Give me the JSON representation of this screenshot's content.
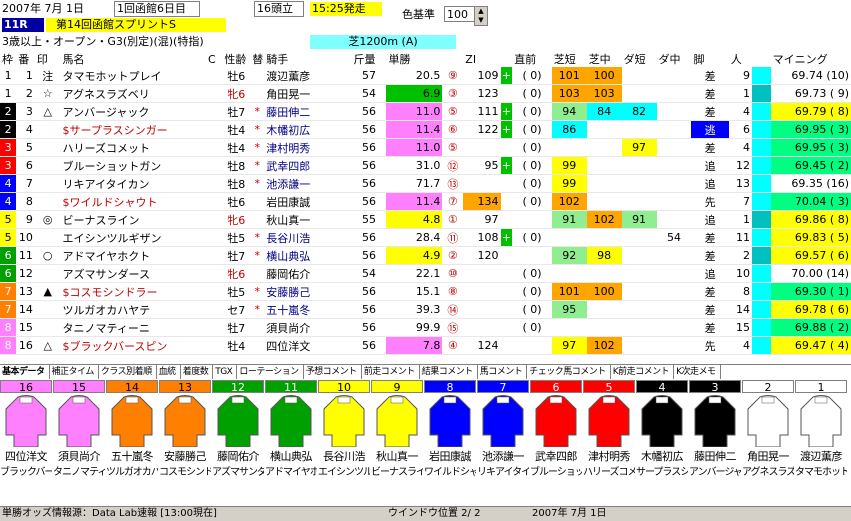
{
  "header": {
    "date": "2007年 7月 1日",
    "meeting": "1回函館6日目",
    "race_no": "11R",
    "race_name": "第14回函館スプリントS",
    "runners": "16頭立",
    "post_time": "15:25発走",
    "color_label": "色基準",
    "color_value": "100",
    "conditions": "3歳以上・オープン・G3(別定)(混)(特指)",
    "course": "芝1200m (A)"
  },
  "columns": [
    "枠",
    "番",
    "印",
    "馬名",
    "C",
    "性齢",
    "替",
    "騎手",
    "斤量",
    "単勝",
    "",
    "ZI",
    "",
    "直前",
    "芝短",
    "芝中",
    "ダ短",
    "ダ中",
    "脚",
    "人",
    "",
    "マイニング"
  ],
  "colors": {
    "waku1": "#ffffff",
    "waku2": "#000000",
    "waku3": "#ff0000",
    "waku4": "#0000ff",
    "waku5": "#ffff00",
    "waku6": "#00a000",
    "waku7": "#ff8000",
    "waku8": "#ff80ff",
    "cyan": "#00ffff",
    "yellow": "#ffff00",
    "orange": "#ffa500",
    "lightgreen": "#90ee90",
    "green": "#00c000",
    "magenta": "#ff00ff",
    "olive": "#00ff80"
  },
  "horses": [
    {
      "waku": "1",
      "num": "1",
      "mark": "注",
      "name": "タマモホットプレイ",
      "c": "",
      "sex": "牡6",
      "change": "",
      "jockey": "渡辺薫彦",
      "wt": "57",
      "odds": "20.5",
      "pop": "⑨",
      "zi": "109",
      "plus": "+",
      "chokuzen": "(  0)",
      "shibatan": "101",
      "shibanaka": "100",
      "datan": "",
      "danaka": "",
      "kyaku": "差",
      "nin": "9",
      "mining": "69.74 (10)"
    },
    {
      "waku": "1",
      "num": "2",
      "mark": "☆",
      "name": "アグネスラズベリ",
      "c": "",
      "sex": "牝6",
      "change": "",
      "jockey": "角田晃一",
      "wt": "54",
      "odds": "6.9",
      "pop": "③",
      "zi": "123",
      "plus": "",
      "chokuzen": "(  0)",
      "shibatan": "103",
      "shibanaka": "103",
      "datan": "",
      "danaka": "",
      "kyaku": "差",
      "nin": "1",
      "mining": "69.73 ( 9)"
    },
    {
      "waku": "2",
      "num": "3",
      "mark": "△",
      "name": "アンバージャック",
      "c": "",
      "sex": "牡7",
      "change": "*",
      "jockey": "藤田伸二",
      "wt": "56",
      "odds": "11.0",
      "pop": "⑤",
      "zi": "111",
      "plus": "+",
      "chokuzen": "(  0)",
      "shibatan": "94",
      "shibanaka": "84",
      "datan": "82",
      "danaka": "",
      "kyaku": "差",
      "nin": "4",
      "mining": "69.79 ( 8)"
    },
    {
      "waku": "2",
      "num": "4",
      "mark": "",
      "name": "$サープラスシンガー",
      "c": "",
      "sex": "牡4",
      "change": "*",
      "jockey": "木幡初広",
      "wt": "56",
      "odds": "11.4",
      "pop": "⑥",
      "zi": "122",
      "plus": "+",
      "chokuzen": "(  0)",
      "shibatan": "86",
      "shibanaka": "",
      "datan": "",
      "danaka": "",
      "kyaku": "逃",
      "nin": "6",
      "mining": "69.95 ( 3)"
    },
    {
      "waku": "3",
      "num": "5",
      "mark": "",
      "name": "ハリーズコメット",
      "c": "",
      "sex": "牡4",
      "change": "*",
      "jockey": "津村明秀",
      "wt": "56",
      "odds": "11.0",
      "pop": "⑤",
      "zi": "",
      "plus": "",
      "chokuzen": "(  0)",
      "shibatan": "",
      "shibanaka": "",
      "datan": "97",
      "danaka": "",
      "kyaku": "差",
      "nin": "4",
      "mining": "69.95 ( 3)"
    },
    {
      "waku": "3",
      "num": "6",
      "mark": "",
      "name": "ブルーショットガン",
      "c": "",
      "sex": "牡8",
      "change": "*",
      "jockey": "武幸四郎",
      "wt": "56",
      "odds": "31.0",
      "pop": "⑫",
      "zi": "95",
      "plus": "+",
      "chokuzen": "(  0)",
      "shibatan": "99",
      "shibanaka": "",
      "datan": "",
      "danaka": "",
      "kyaku": "追",
      "nin": "12",
      "mining": "69.45 ( 2)"
    },
    {
      "waku": "4",
      "num": "7",
      "mark": "",
      "name": "リキアイタイカン",
      "c": "",
      "sex": "牡8",
      "change": "*",
      "jockey": "池添謙一",
      "wt": "56",
      "odds": "71.7",
      "pop": "⑬",
      "zi": "",
      "plus": "",
      "chokuzen": "(  0)",
      "shibatan": "99",
      "shibanaka": "",
      "datan": "",
      "danaka": "",
      "kyaku": "追",
      "nin": "13",
      "mining": "69.35 (16)"
    },
    {
      "waku": "4",
      "num": "8",
      "mark": "",
      "name": "$ワイルドシャウト",
      "c": "",
      "sex": "牡6",
      "change": "",
      "jockey": "岩田康誠",
      "wt": "56",
      "odds": "11.4",
      "pop": "⑦",
      "zi": "134",
      "plus": "",
      "chokuzen": "(  0)",
      "shibatan": "102",
      "shibanaka": "",
      "datan": "",
      "danaka": "",
      "kyaku": "先",
      "nin": "7",
      "mining": "70.04 ( 3)"
    },
    {
      "waku": "5",
      "num": "9",
      "mark": "◎",
      "name": "ビーナスライン",
      "c": "",
      "sex": "牝6",
      "change": "",
      "jockey": "秋山真一",
      "wt": "55",
      "odds": "4.8",
      "pop": "①",
      "zi": "97",
      "plus": "",
      "chokuzen": "",
      ",shibatan": "91",
      "shibatan": "91",
      "shibanaka": "102",
      "datan": "91",
      "danaka": "",
      "kyaku": "追",
      "nin": "1",
      "mining": "69.86 ( 8)"
    },
    {
      "waku": "5",
      "num": "10",
      "mark": "",
      "name": "エイシンツルギザン",
      "c": "",
      "sex": "牡5",
      "change": "*",
      "jockey": "長谷川浩",
      "wt": "56",
      "odds": "28.4",
      "pop": "⑪",
      "zi": "108",
      "plus": "+",
      "chokuzen": "(  0)",
      "shibatan": "",
      "shibanaka": "",
      "datan": "",
      "danaka": "54",
      "kyaku": "差",
      "nin": "11",
      "mining": "69.83 ( 5)"
    },
    {
      "waku": "6",
      "num": "11",
      "mark": "○",
      "name": "アドマイヤホクト",
      "c": "",
      "sex": "牡7",
      "change": "*",
      "jockey": "横山典弘",
      "wt": "56",
      "odds": "4.9",
      "pop": "②",
      "zi": "120",
      "plus": "",
      "chokuzen": "",
      "shibatan": "92",
      "shibanaka": "98",
      "datan": "",
      "danaka": "",
      "kyaku": "差",
      "nin": "2",
      "mining": "69.57 ( 6)"
    },
    {
      "waku": "6",
      "num": "12",
      "mark": "",
      "name": "アズマサンダース",
      "c": "",
      "sex": "牝6",
      "change": "",
      "jockey": "藤岡佑介",
      "wt": "54",
      "odds": "22.1",
      "pop": "⑩",
      "zi": "",
      "plus": "",
      "chokuzen": "(  0)",
      "shibatan": "",
      "shibanaka": "",
      "datan": "",
      "danaka": "",
      "kyaku": "追",
      "nin": "10",
      "mining": "70.00 (14)"
    },
    {
      "waku": "7",
      "num": "13",
      "mark": "▲",
      "name": "$コスモシンドラー",
      "c": "",
      "sex": "牡5",
      "change": "*",
      "jockey": "安藤勝己",
      "wt": "56",
      "odds": "15.1",
      "pop": "⑧",
      "zi": "",
      "plus": "",
      "chokuzen": "(  0)",
      "shibatan": "101",
      "shibanaka": "100",
      "datan": "",
      "danaka": "",
      "kyaku": "差",
      "nin": "8",
      "mining": "69.30 ( 1)"
    },
    {
      "waku": "7",
      "num": "14",
      "mark": "",
      "name": "ツルガオカハヤテ",
      "c": "",
      "sex": "セ7",
      "change": "*",
      "jockey": "五十嵐冬",
      "wt": "56",
      "odds": "39.3",
      "pop": "⑭",
      "zi": "",
      "plus": "",
      "chokuzen": "(  0)",
      "shibatan": "95",
      "shibanaka": "",
      "datan": "",
      "danaka": "",
      "kyaku": "差",
      "nin": "14",
      "mining": "69.78 ( 6)"
    },
    {
      "waku": "8",
      "num": "15",
      "mark": "",
      "name": "タニノマティーニ",
      "c": "",
      "sex": "牡7",
      "change": "",
      "jockey": "須貝尚介",
      "wt": "56",
      "odds": "99.9",
      "pop": "⑮",
      "zi": "",
      "plus": "",
      "chokuzen": "(  0)",
      "shibatan": "",
      "shibanaka": "",
      "datan": "",
      "danaka": "",
      "kyaku": "差",
      "nin": "15",
      "mining": "69.88 ( 2)"
    },
    {
      "waku": "8",
      "num": "16",
      "mark": "△",
      "name": "$ブラックバースピン",
      "c": "",
      "sex": "牡4",
      "change": "",
      "jockey": "四位洋文",
      "wt": "56",
      "odds": "7.8",
      "pop": "④",
      "zi": "124",
      "plus": "",
      "chokuzen": "",
      "shibatan": "97",
      "shibanaka": "102",
      "datan": "",
      "danaka": "",
      "kyaku": "先",
      "nin": "4",
      "mining": "69.47 ( 4)"
    }
  ],
  "tabs": [
    "基本データ",
    "補正タイム",
    "クラス別着順",
    "血統",
    "着度数",
    "TGX",
    "ローテーション",
    "予想コメント",
    "前走コメント",
    "結果コメント",
    "馬コメント",
    "チェック馬コメント",
    "K前走コメント",
    "K次走メモ"
  ],
  "silks": [
    {
      "num": "16",
      "jockey": "四位洋文",
      "horse": "ブラックバースピン",
      "bg": "#ff80ff",
      "fg": "#000"
    },
    {
      "num": "15",
      "jockey": "須貝尚介",
      "horse": "タニノマティーニ",
      "bg": "#ff80ff",
      "fg": "#000"
    },
    {
      "num": "14",
      "jockey": "五十嵐冬",
      "horse": "ツルガオカハヤテ",
      "bg": "#ff8000",
      "fg": "#000"
    },
    {
      "num": "13",
      "jockey": "安藤勝己",
      "horse": "コスモシンドラー",
      "bg": "#ff8000",
      "fg": "#000"
    },
    {
      "num": "12",
      "jockey": "藤岡佑介",
      "horse": "アズマサンダース",
      "bg": "#00a000",
      "fg": "#fff"
    },
    {
      "num": "11",
      "jockey": "横山典弘",
      "horse": "アドマイヤホクト",
      "bg": "#00a000",
      "fg": "#fff"
    },
    {
      "num": "10",
      "jockey": "長谷川浩",
      "horse": "エイシンツルギザン",
      "bg": "#ffff00",
      "fg": "#000"
    },
    {
      "num": "9",
      "jockey": "秋山真一",
      "horse": "ビーナスライン",
      "bg": "#ffff00",
      "fg": "#000"
    },
    {
      "num": "8",
      "jockey": "岩田康誠",
      "horse": "ワイルドシャウト",
      "bg": "#0000ff",
      "fg": "#fff"
    },
    {
      "num": "7",
      "jockey": "池添謙一",
      "horse": "リキアイタイカン",
      "bg": "#0000ff",
      "fg": "#fff"
    },
    {
      "num": "6",
      "jockey": "武幸四郎",
      "horse": "ブルーショットガン",
      "bg": "#ff0000",
      "fg": "#fff"
    },
    {
      "num": "5",
      "jockey": "津村明秀",
      "horse": "ハリーズコメット",
      "bg": "#ff0000",
      "fg": "#fff"
    },
    {
      "num": "4",
      "jockey": "木幡初広",
      "horse": "サープラスシンガー",
      "bg": "#000000",
      "fg": "#fff"
    },
    {
      "num": "3",
      "jockey": "藤田伸二",
      "horse": "アンバージャック",
      "bg": "#000000",
      "fg": "#fff"
    },
    {
      "num": "2",
      "jockey": "角田晃一",
      "horse": "アグネスラズベリ",
      "bg": "#ffffff",
      "fg": "#000"
    },
    {
      "num": "1",
      "jockey": "渡辺薫彦",
      "horse": "タマモホットプレイ",
      "bg": "#ffffff",
      "fg": "#000"
    }
  ],
  "status": {
    "source": "単勝オッズ情報源：Data Lab速報 [13:00現在]",
    "window_pos": "ウインドウ位置 2/ 2",
    "date": "2007年 7月 1日"
  }
}
